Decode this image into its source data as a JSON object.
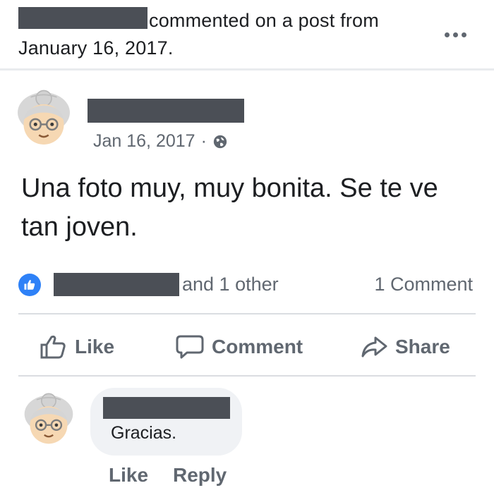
{
  "header": {
    "action_text": "commented on a post from",
    "date_text": "January 16, 2017.",
    "more_icon": "more-horizontal-icon"
  },
  "post": {
    "date": "Jan 16, 2017",
    "separator": "·",
    "privacy_icon": "globe-icon",
    "text": "Una foto muy, muy bonita. Se te ve tan joven."
  },
  "reactions": {
    "icon": "like-thumb-icon",
    "others_text": "and 1 other",
    "comment_count": "1 Comment"
  },
  "actions": {
    "like": "Like",
    "comment": "Comment",
    "share": "Share"
  },
  "comment": {
    "text": "Gracias.",
    "like": "Like",
    "reply": "Reply"
  },
  "colors": {
    "redaction": "#4b4f56",
    "like_blue": "#2e81f7",
    "muted_text": "#606770",
    "bubble_bg": "#f0f2f5"
  }
}
